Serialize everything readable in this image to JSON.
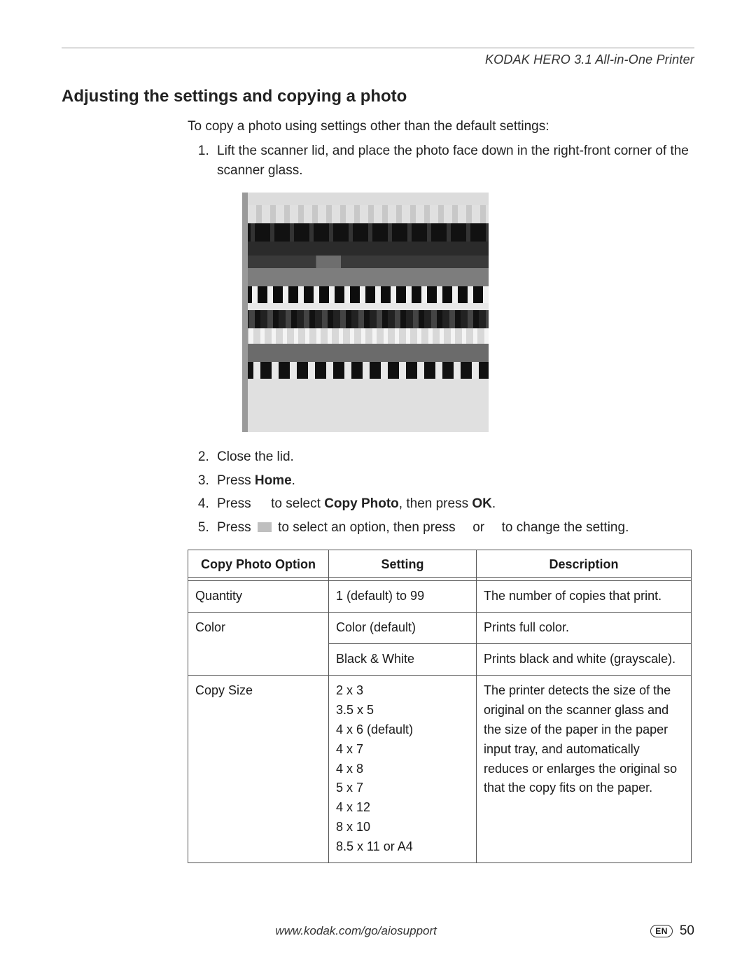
{
  "header": {
    "product": "KODAK HERO 3.1 All-in-One Printer"
  },
  "section_title": "Adjusting the settings and copying a photo",
  "intro": "To copy a photo using settings other than the default settings:",
  "steps": {
    "s1": "Lift the scanner lid, and place the photo face down in the right-front corner of the scanner glass.",
    "s2": "Close the lid.",
    "s3_pre": "Press ",
    "s3_bold": "Home",
    "s3_post": ".",
    "s4_pre": "Press ",
    "s4_mid": " to select ",
    "s4_bold1": "Copy Photo",
    "s4_mid2": ", then press ",
    "s4_bold2": "OK",
    "s4_post": ".",
    "s5_pre": "Press ",
    "s5_mid": " to select an option, then press ",
    "s5_mid2": " or ",
    "s5_post": " to change the setting."
  },
  "table": {
    "headers": {
      "option": "Copy Photo Option",
      "setting": "Setting",
      "description": "Description"
    },
    "rows": {
      "quantity": {
        "option": "Quantity",
        "setting": "1 (default) to 99",
        "description": "The number of copies that print."
      },
      "color1": {
        "option": "Color",
        "setting": "Color (default)",
        "description": "Prints full color."
      },
      "color2": {
        "setting": "Black & White",
        "description": "Prints black and white (grayscale)."
      },
      "copysize": {
        "option": "Copy Size",
        "settings": {
          "a": "2 x 3",
          "b": "3.5 x 5",
          "c": "4 x 6 (default)",
          "d": "4 x 7",
          "e": "4 x 8",
          "f": "5 x 7",
          "g": "4 x 12",
          "h": "8 x 10",
          "i": "8.5 x 11 or A4"
        },
        "description": "The printer detects the size of the original on the scanner glass and the size of the paper in the paper input tray, and automatically reduces or enlarges the original so that the copy fits on the paper."
      }
    }
  },
  "footer": {
    "url": "www.kodak.com/go/aiosupport",
    "lang": "EN",
    "page": "50"
  }
}
